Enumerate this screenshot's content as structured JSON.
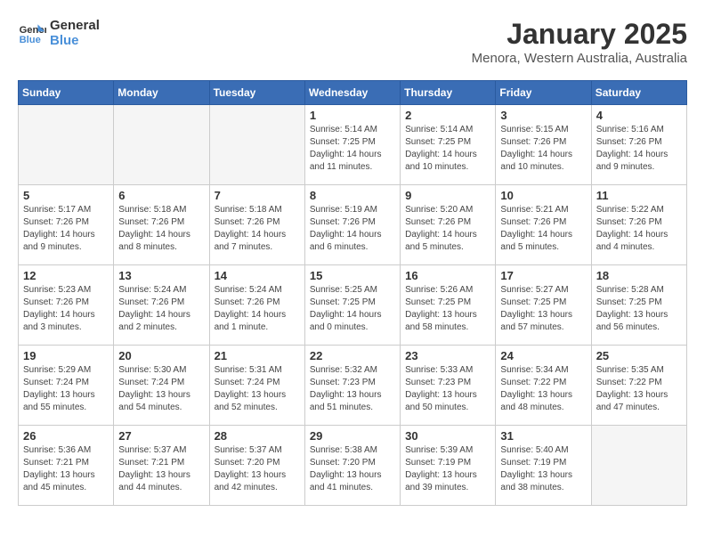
{
  "header": {
    "logo_line1": "General",
    "logo_line2": "Blue",
    "month": "January 2025",
    "location": "Menora, Western Australia, Australia"
  },
  "days_of_week": [
    "Sunday",
    "Monday",
    "Tuesday",
    "Wednesday",
    "Thursday",
    "Friday",
    "Saturday"
  ],
  "weeks": [
    [
      {
        "day": "",
        "info": ""
      },
      {
        "day": "",
        "info": ""
      },
      {
        "day": "",
        "info": ""
      },
      {
        "day": "1",
        "info": "Sunrise: 5:14 AM\nSunset: 7:25 PM\nDaylight: 14 hours\nand 11 minutes."
      },
      {
        "day": "2",
        "info": "Sunrise: 5:14 AM\nSunset: 7:25 PM\nDaylight: 14 hours\nand 10 minutes."
      },
      {
        "day": "3",
        "info": "Sunrise: 5:15 AM\nSunset: 7:26 PM\nDaylight: 14 hours\nand 10 minutes."
      },
      {
        "day": "4",
        "info": "Sunrise: 5:16 AM\nSunset: 7:26 PM\nDaylight: 14 hours\nand 9 minutes."
      }
    ],
    [
      {
        "day": "5",
        "info": "Sunrise: 5:17 AM\nSunset: 7:26 PM\nDaylight: 14 hours\nand 9 minutes."
      },
      {
        "day": "6",
        "info": "Sunrise: 5:18 AM\nSunset: 7:26 PM\nDaylight: 14 hours\nand 8 minutes."
      },
      {
        "day": "7",
        "info": "Sunrise: 5:18 AM\nSunset: 7:26 PM\nDaylight: 14 hours\nand 7 minutes."
      },
      {
        "day": "8",
        "info": "Sunrise: 5:19 AM\nSunset: 7:26 PM\nDaylight: 14 hours\nand 6 minutes."
      },
      {
        "day": "9",
        "info": "Sunrise: 5:20 AM\nSunset: 7:26 PM\nDaylight: 14 hours\nand 5 minutes."
      },
      {
        "day": "10",
        "info": "Sunrise: 5:21 AM\nSunset: 7:26 PM\nDaylight: 14 hours\nand 5 minutes."
      },
      {
        "day": "11",
        "info": "Sunrise: 5:22 AM\nSunset: 7:26 PM\nDaylight: 14 hours\nand 4 minutes."
      }
    ],
    [
      {
        "day": "12",
        "info": "Sunrise: 5:23 AM\nSunset: 7:26 PM\nDaylight: 14 hours\nand 3 minutes."
      },
      {
        "day": "13",
        "info": "Sunrise: 5:24 AM\nSunset: 7:26 PM\nDaylight: 14 hours\nand 2 minutes."
      },
      {
        "day": "14",
        "info": "Sunrise: 5:24 AM\nSunset: 7:26 PM\nDaylight: 14 hours\nand 1 minute."
      },
      {
        "day": "15",
        "info": "Sunrise: 5:25 AM\nSunset: 7:25 PM\nDaylight: 14 hours\nand 0 minutes."
      },
      {
        "day": "16",
        "info": "Sunrise: 5:26 AM\nSunset: 7:25 PM\nDaylight: 13 hours\nand 58 minutes."
      },
      {
        "day": "17",
        "info": "Sunrise: 5:27 AM\nSunset: 7:25 PM\nDaylight: 13 hours\nand 57 minutes."
      },
      {
        "day": "18",
        "info": "Sunrise: 5:28 AM\nSunset: 7:25 PM\nDaylight: 13 hours\nand 56 minutes."
      }
    ],
    [
      {
        "day": "19",
        "info": "Sunrise: 5:29 AM\nSunset: 7:24 PM\nDaylight: 13 hours\nand 55 minutes."
      },
      {
        "day": "20",
        "info": "Sunrise: 5:30 AM\nSunset: 7:24 PM\nDaylight: 13 hours\nand 54 minutes."
      },
      {
        "day": "21",
        "info": "Sunrise: 5:31 AM\nSunset: 7:24 PM\nDaylight: 13 hours\nand 52 minutes."
      },
      {
        "day": "22",
        "info": "Sunrise: 5:32 AM\nSunset: 7:23 PM\nDaylight: 13 hours\nand 51 minutes."
      },
      {
        "day": "23",
        "info": "Sunrise: 5:33 AM\nSunset: 7:23 PM\nDaylight: 13 hours\nand 50 minutes."
      },
      {
        "day": "24",
        "info": "Sunrise: 5:34 AM\nSunset: 7:22 PM\nDaylight: 13 hours\nand 48 minutes."
      },
      {
        "day": "25",
        "info": "Sunrise: 5:35 AM\nSunset: 7:22 PM\nDaylight: 13 hours\nand 47 minutes."
      }
    ],
    [
      {
        "day": "26",
        "info": "Sunrise: 5:36 AM\nSunset: 7:21 PM\nDaylight: 13 hours\nand 45 minutes."
      },
      {
        "day": "27",
        "info": "Sunrise: 5:37 AM\nSunset: 7:21 PM\nDaylight: 13 hours\nand 44 minutes."
      },
      {
        "day": "28",
        "info": "Sunrise: 5:37 AM\nSunset: 7:20 PM\nDaylight: 13 hours\nand 42 minutes."
      },
      {
        "day": "29",
        "info": "Sunrise: 5:38 AM\nSunset: 7:20 PM\nDaylight: 13 hours\nand 41 minutes."
      },
      {
        "day": "30",
        "info": "Sunrise: 5:39 AM\nSunset: 7:19 PM\nDaylight: 13 hours\nand 39 minutes."
      },
      {
        "day": "31",
        "info": "Sunrise: 5:40 AM\nSunset: 7:19 PM\nDaylight: 13 hours\nand 38 minutes."
      },
      {
        "day": "",
        "info": ""
      }
    ]
  ]
}
